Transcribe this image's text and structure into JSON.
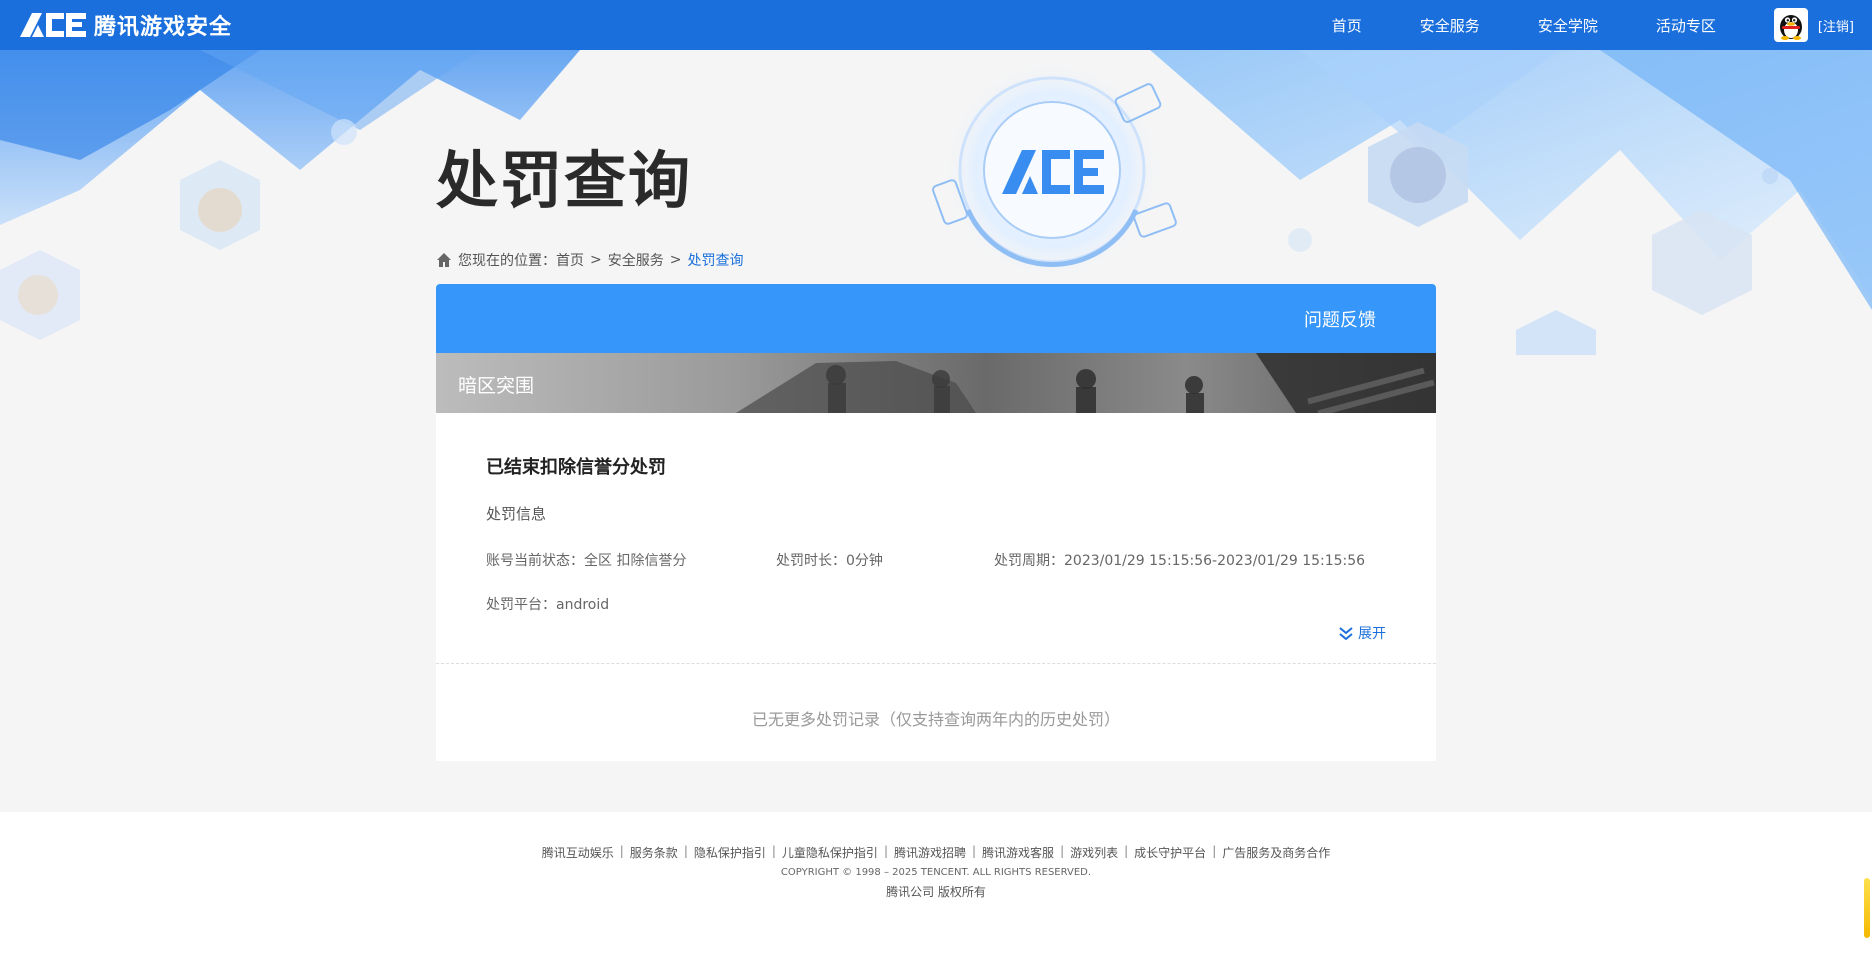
{
  "header": {
    "brand": "腾讯游戏安全",
    "logo_text": "ACE",
    "nav": [
      {
        "label": "首页"
      },
      {
        "label": "安全服务"
      },
      {
        "label": "安全学院"
      },
      {
        "label": "活动专区"
      }
    ],
    "logout": "[注销]",
    "avatar_icon": "qq-penguin-icon"
  },
  "hero": {
    "title": "处罚查询",
    "badge_text": "ACE"
  },
  "breadcrumb": {
    "prefix": "您现在的位置：",
    "items": [
      "首页",
      "安全服务",
      "处罚查询"
    ],
    "separator": ">"
  },
  "card": {
    "feedback": "问题反馈",
    "game": "暗区突围",
    "record": {
      "title": "已结束扣除信誉分处罚",
      "section": "处罚信息",
      "status_label": "账号当前状态：",
      "status_value": "全区 扣除信誉分",
      "duration_label": "处罚时长：",
      "duration_value": "0分钟",
      "period_label": "处罚周期：",
      "period_value": "2023/01/29 15:15:56-2023/01/29 15:15:56",
      "platform_label": "处罚平台：",
      "platform_value": "android",
      "expand": "展开"
    },
    "no_more": "已无更多处罚记录（仅支持查询两年内的历史处罚）"
  },
  "footer": {
    "links": [
      "腾讯互动娱乐",
      "服务条款",
      "隐私保护指引",
      "儿童隐私保护指引",
      "腾讯游戏招聘",
      "腾讯游戏客服",
      "游戏列表",
      "成长守护平台",
      "广告服务及商务合作"
    ],
    "copyright": "COPYRIGHT © 1998 – 2025 TENCENT. ALL RIGHTS RESERVED.",
    "company": "腾讯公司 版权所有"
  },
  "colors": {
    "topbar": "#1a6fdc",
    "card_header": "#3796f9",
    "link": "#1a6fdc"
  }
}
